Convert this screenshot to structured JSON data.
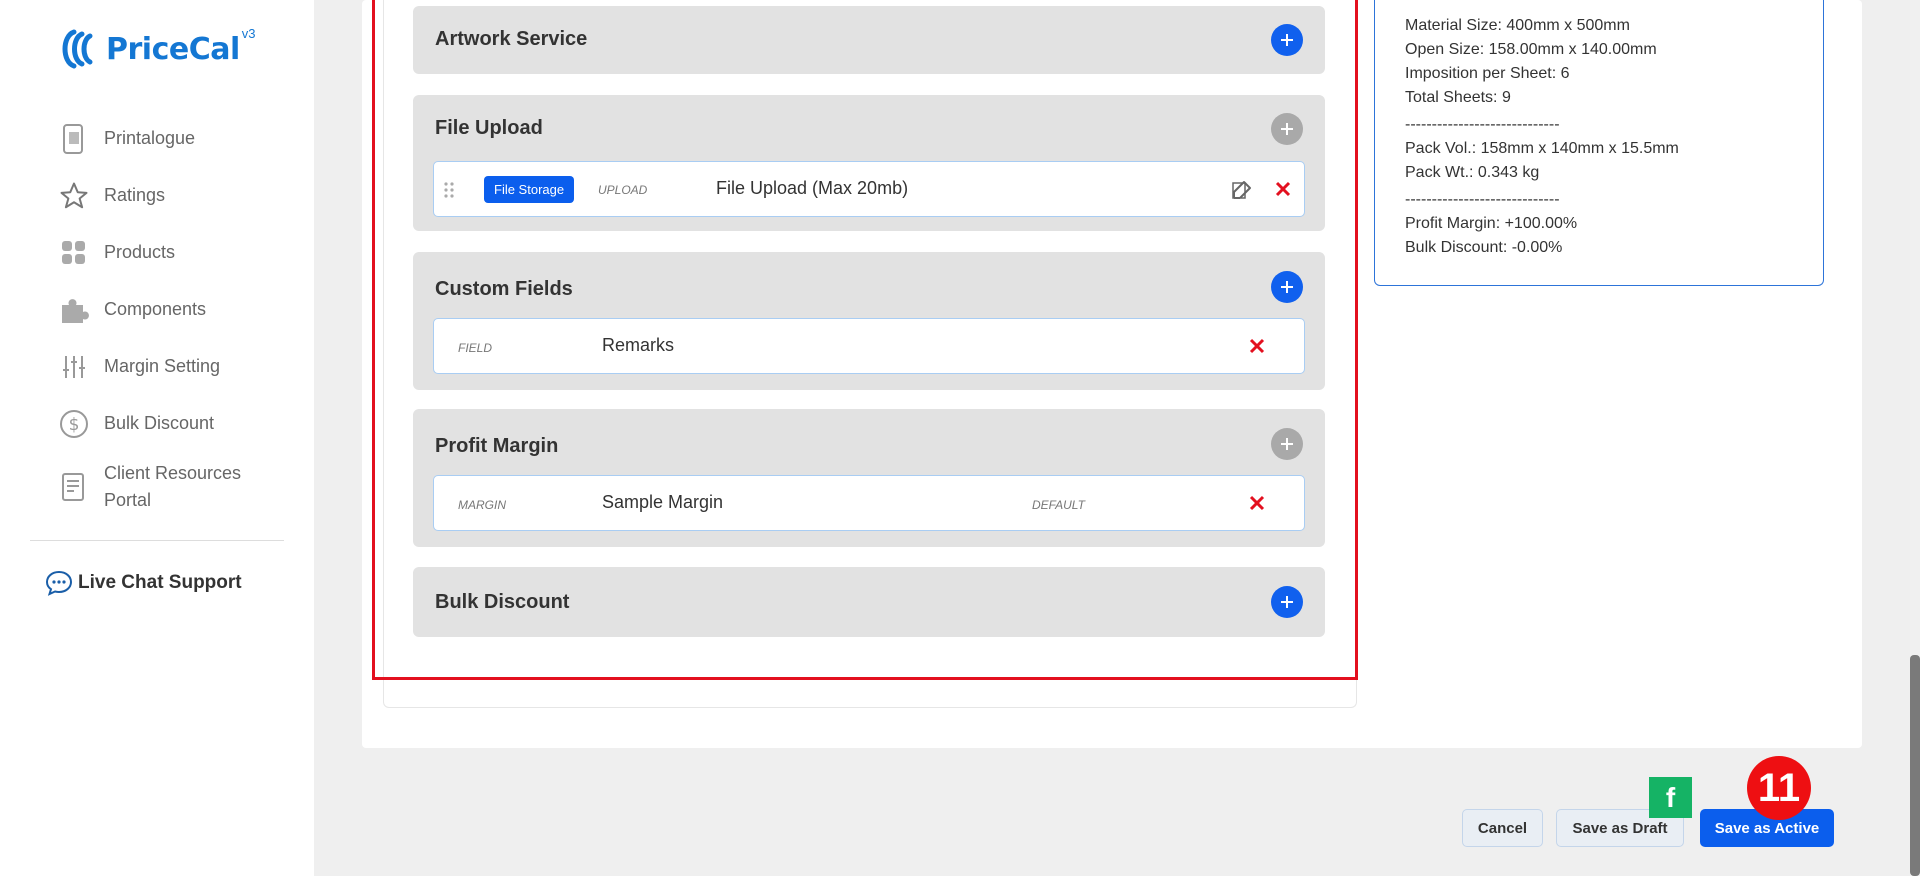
{
  "brand": {
    "name": "PriceCal",
    "version": "v3",
    "accent": "#1477d3"
  },
  "sidebar": {
    "items": [
      {
        "label": "Printalogue",
        "icon": "phone-catalog-icon"
      },
      {
        "label": "Ratings",
        "icon": "star-icon"
      },
      {
        "label": "Products",
        "icon": "grid-icon"
      },
      {
        "label": "Components",
        "icon": "puzzle-icon"
      },
      {
        "label": "Margin Setting",
        "icon": "sliders-icon"
      },
      {
        "label": "Bulk Discount",
        "icon": "dollar-circle-icon"
      },
      {
        "label": "Client Resources Portal",
        "icon": "document-icon"
      }
    ],
    "live_chat": "Live Chat Support"
  },
  "sections": {
    "artwork": {
      "title": "Artwork Service"
    },
    "file_upload": {
      "title": "File Upload",
      "row": {
        "badge": "File Storage",
        "tag": "UPLOAD",
        "value": "File Upload (Max 20mb)"
      }
    },
    "custom_fields": {
      "title": "Custom Fields",
      "row": {
        "tag": "FIELD",
        "value": "Remarks"
      }
    },
    "profit_margin": {
      "title": "Profit Margin",
      "row": {
        "tag": "MARGIN",
        "value": "Sample Margin",
        "status": "DEFAULT"
      }
    },
    "bulk_discount": {
      "title": "Bulk Discount"
    }
  },
  "summary": {
    "material_size": "Material Size: 400mm x 500mm",
    "open_size": "Open Size: 158.00mm x 140.00mm",
    "imposition": "Imposition per Sheet: 6",
    "total_sheets": "Total Sheets: 9",
    "separator": "-----------------------------",
    "pack_vol": "Pack Vol.: 158mm x 140mm x 15.5mm",
    "pack_wt": "Pack Wt.: 0.343 kg",
    "profit_margin": "Profit Margin: +100.00%",
    "bulk_discount": "Bulk Discount: -0.00%"
  },
  "actions": {
    "cancel": "Cancel",
    "save_draft": "Save as Draft",
    "save_active": "Save as Active"
  },
  "markers": {
    "f": "f",
    "step": "11"
  },
  "colors": {
    "primary": "#0b5eed",
    "danger": "#e3101f",
    "marker_green": "#15b365"
  }
}
